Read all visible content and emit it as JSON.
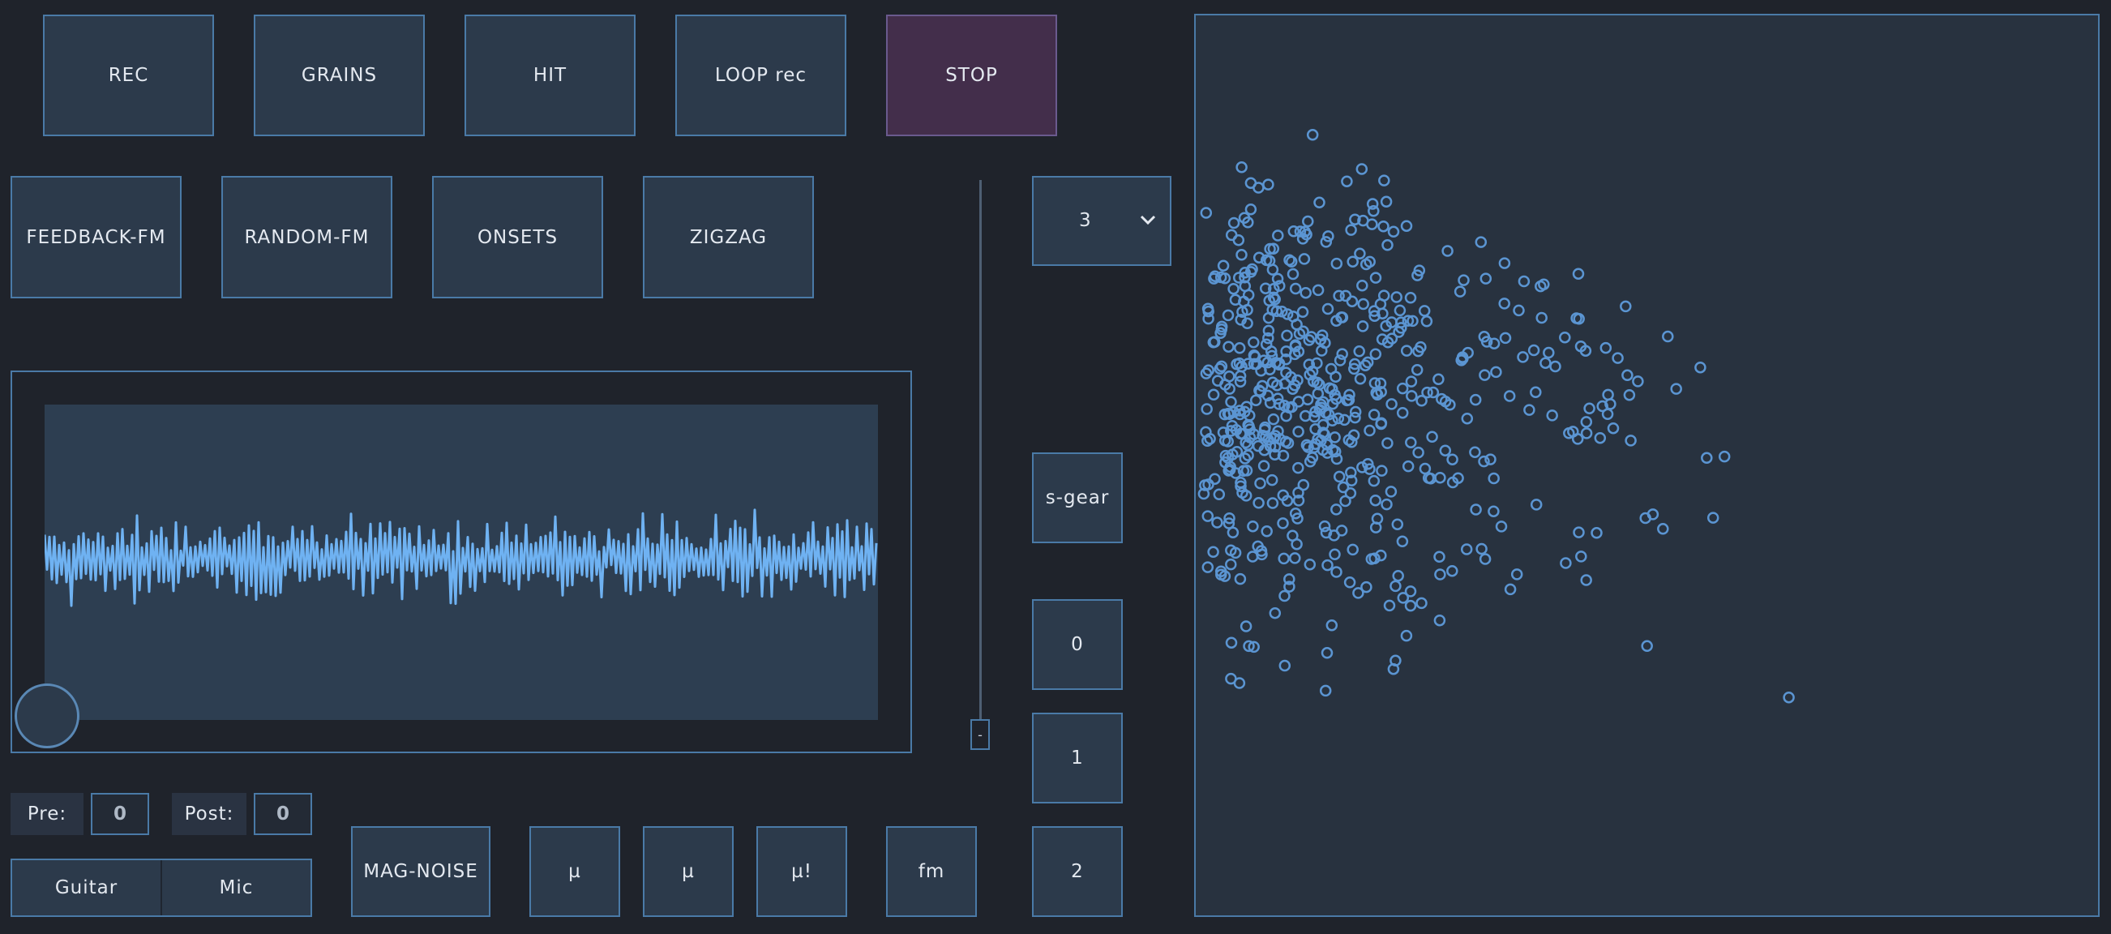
{
  "row1": {
    "rec": "REC",
    "grains": "GRAINS",
    "hit": "HIT",
    "loop": "LOOP rec",
    "stop": "STOP"
  },
  "row2": {
    "feedback_fm": "FEEDBACK-FM",
    "random_fm": "RANDOM-FM",
    "onsets": "ONSETS",
    "zigzag": "ZIGZAG"
  },
  "dropdown": {
    "value": "3"
  },
  "side_buttons": {
    "s_gear": "s-gear",
    "b0": "0",
    "b1": "1",
    "b2": "2"
  },
  "slider": {
    "handle_label": "-",
    "value": 0.0
  },
  "prepost": {
    "pre_label": "Pre:",
    "pre_value": "0",
    "post_label": "Post:",
    "post_value": "0"
  },
  "input_source": {
    "guitar": "Guitar",
    "mic": "Mic"
  },
  "bottom": {
    "mag_noise": "MAG-NOISE",
    "mu1": "µ",
    "mu2": "µ",
    "mu3": "µ!",
    "fm": "fm"
  },
  "colors": {
    "accent": "#4a7aa7",
    "wave": "#6fb2f2",
    "point": "#5b95d2",
    "stop_bg": "#432e4b"
  }
}
